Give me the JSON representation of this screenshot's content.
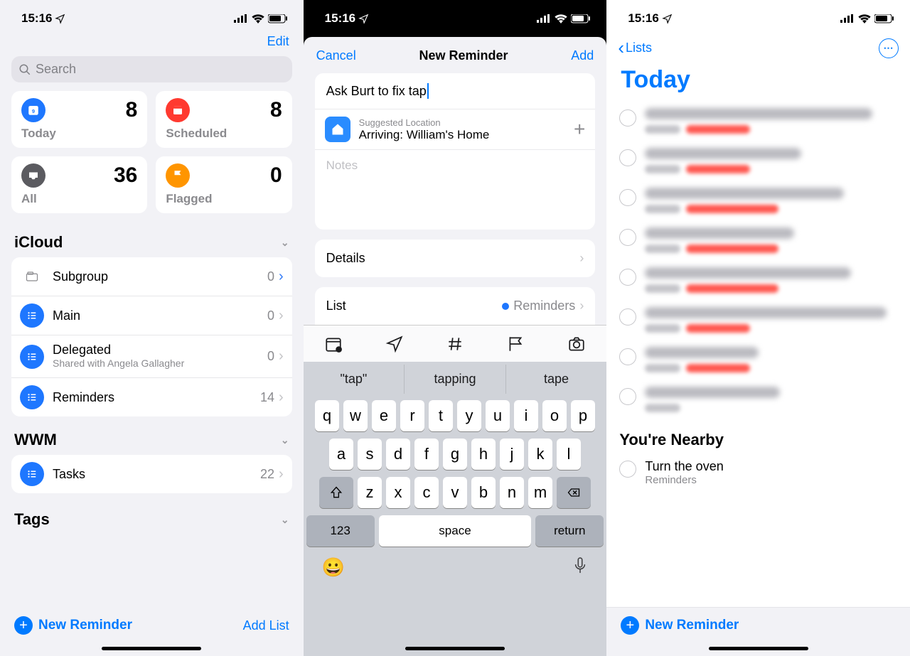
{
  "status": {
    "time": "15:16"
  },
  "p1": {
    "edit": "Edit",
    "search_placeholder": "Search",
    "cards": {
      "today": {
        "label": "Today",
        "count": "8"
      },
      "scheduled": {
        "label": "Scheduled",
        "count": "8"
      },
      "all": {
        "label": "All",
        "count": "36"
      },
      "flagged": {
        "label": "Flagged",
        "count": "0"
      }
    },
    "section_icloud": "iCloud",
    "icloud_lists": [
      {
        "name": "Subgroup",
        "count": "0",
        "folder": true
      },
      {
        "name": "Main",
        "count": "0"
      },
      {
        "name": "Delegated",
        "count": "0",
        "sub": "Shared with Angela Gallagher"
      },
      {
        "name": "Reminders",
        "count": "14"
      }
    ],
    "section_wwm": "WWM",
    "wwm_lists": [
      {
        "name": "Tasks",
        "count": "22"
      }
    ],
    "tags": "Tags",
    "new_reminder": "New Reminder",
    "add_list": "Add List"
  },
  "p2": {
    "cancel": "Cancel",
    "title": "New Reminder",
    "add": "Add",
    "input_title": "Ask Burt to fix tap",
    "suggested_location_label": "Suggested Location",
    "arriving": "Arriving: William's Home",
    "notes_placeholder": "Notes",
    "details": "Details",
    "list_label": "List",
    "list_value": "Reminders",
    "suggestions": [
      "\"tap\"",
      "tapping",
      "tape"
    ],
    "kb": {
      "row1": [
        "q",
        "w",
        "e",
        "r",
        "t",
        "y",
        "u",
        "i",
        "o",
        "p"
      ],
      "row2": [
        "a",
        "s",
        "d",
        "f",
        "g",
        "h",
        "j",
        "k",
        "l"
      ],
      "row3": [
        "z",
        "x",
        "c",
        "v",
        "b",
        "n",
        "m"
      ],
      "k123": "123",
      "space": "space",
      "ret": "return"
    }
  },
  "p3": {
    "back": "Lists",
    "heading": "Today",
    "nearby_heading": "You're Nearby",
    "nearby_item_title": "Turn the oven",
    "nearby_item_sub": "Reminders",
    "new_reminder": "New Reminder",
    "blurred_items_count": 8
  }
}
